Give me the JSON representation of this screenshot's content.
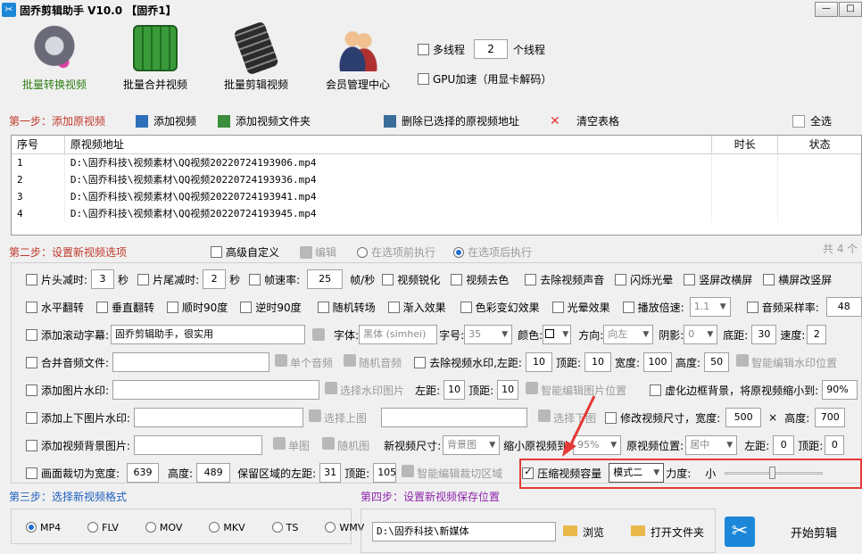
{
  "window": {
    "title": "固乔剪辑助手 V10.0 【固乔1】",
    "buttons": [
      "—",
      "□"
    ]
  },
  "toolbar": {
    "tools": [
      {
        "label": "批量转换视频",
        "active": true
      },
      {
        "label": "批量合并视频",
        "active": false
      },
      {
        "label": "批量剪辑视频",
        "active": false
      },
      {
        "label": "会员管理中心",
        "active": false
      }
    ],
    "multithread_label": "多线程",
    "thread_count": "2",
    "thread_unit": "个线程",
    "gpu_label": "GPU加速（用显卡解码）"
  },
  "step1": {
    "title": "第一步：添加原视频",
    "add_video": "添加视频",
    "add_folder": "添加视频文件夹",
    "delete_selected": "删除已选择的原视频地址",
    "clear_table": "清空表格",
    "select_all": "全选"
  },
  "table": {
    "headers": [
      "序号",
      "原视频地址",
      "时长",
      "状态"
    ],
    "rows": [
      {
        "no": "1",
        "path": "D:\\固乔科技\\视频素材\\QQ视频20220724193906.mp4"
      },
      {
        "no": "2",
        "path": "D:\\固乔科技\\视频素材\\QQ视频20220724193936.mp4"
      },
      {
        "no": "3",
        "path": "D:\\固乔科技\\视频素材\\QQ视频20220724193941.mp4"
      },
      {
        "no": "4",
        "path": "D:\\固乔科技\\视频素材\\QQ视频20220724193945.mp4"
      }
    ]
  },
  "step2": {
    "title": "第二步：设置新视频选项",
    "advanced": "高级自定义",
    "edit": "编辑",
    "before": "在选项前执行",
    "after": "在选项后执行",
    "count": "共 4 个"
  },
  "options": {
    "r1": {
      "cut_head": "片头减时:",
      "head_val": "3",
      "sec": "秒",
      "cut_tail": "片尾减时:",
      "tail_val": "2",
      "fps": "帧速率:",
      "fps_val": "25",
      "fps_unit": "帧/秒",
      "sharpen": "视频锐化",
      "decolor": "视频去色",
      "mute": "去除视频声音",
      "flash": "闪烁光晕",
      "v2h": "竖屏改横屏",
      "h2v": "横屏改竖屏"
    },
    "r2": {
      "hflip": "水平翻转",
      "vflip": "垂直翻转",
      "cw90": "顺时90度",
      "ccw90": "逆时90度",
      "random": "随机转场",
      "fadein": "渐入效果",
      "color": "色彩变幻效果",
      "halo": "光晕效果",
      "speed": "播放倍速:",
      "speed_val": "1.1",
      "sample": "音频采样率:",
      "sample_val": "48"
    },
    "r3": {
      "scroll": "添加滚动字幕:",
      "scroll_text": "固乔剪辑助手，很实用",
      "font": "字体:",
      "font_val": "黑体 (simhei)",
      "size": "字号:",
      "size_val": "35",
      "color": "颜色:",
      "dir": "方向:",
      "dir_val": "向左",
      "shadow": "阴影:",
      "shadow_val": "0",
      "bottom": "底距:",
      "bottom_val": "30",
      "spd": "速度:",
      "spd_val": "2"
    },
    "r4": {
      "merge": "合并音频文件:",
      "single": "单个音频",
      "random": "随机音频",
      "rm_wm": "去除视频水印,",
      "left": "左距:",
      "left_val": "10",
      "top": "顶距:",
      "top_val": "10",
      "w": "宽度:",
      "w_val": "100",
      "h": "高度:",
      "h_val": "50",
      "smart": "智能编辑水印位置"
    },
    "r5": {
      "img_wm": "添加图片水印:",
      "pick": "选择水印图片",
      "left": "左距:",
      "left_val": "10",
      "top": "顶距:",
      "top_val": "10",
      "smart": "智能编辑图片位置",
      "blur": "虚化边框背景，将原视频缩小到:",
      "blur_val": "90%"
    },
    "r6": {
      "tb_img": "添加上下图片水印:",
      "pick_top": "选择上图",
      "pick_bottom": "选择下图",
      "resize": "修改视频尺寸，宽度:",
      "w_val": "500",
      "x": "×",
      "h": "高度:",
      "h_val": "700"
    },
    "r7": {
      "bg_img": "添加视频背景图片:",
      "single": "单图",
      "random": "随机图",
      "new_size": "新视频尺寸:",
      "new_size_val": "背景图",
      "shrink": "缩小原视频到:",
      "shrink_val": "95%",
      "pos": "原视频位置:",
      "pos_val": "居中",
      "left": "左距:",
      "left_val": "0",
      "top": "顶距:",
      "top_val": "0"
    },
    "r8": {
      "crop": "画面裁切为宽度:",
      "w_val": "639",
      "h": "高度:",
      "h_val": "489",
      "keep": "保留区域的左距:",
      "left_val": "31",
      "top": "顶距:",
      "top_val": "105",
      "smart": "智能编辑裁切区域",
      "compress": "压缩视频容量",
      "mode_val": "模式二",
      "force": "力度:",
      "small": "小"
    }
  },
  "step3": {
    "title": "第三步：选择新视频格式",
    "formats": [
      "MP4",
      "FLV",
      "MOV",
      "MKV",
      "TS",
      "WMV"
    ]
  },
  "step4": {
    "title": "第四步：设置新视频保存位置",
    "path": "D:\\固乔科技\\新媒体",
    "browse": "浏览",
    "open_folder": "打开文件夹",
    "start": "开始剪辑"
  },
  "colors": {
    "step_red": "#c0392b",
    "step_blue": "#1f5fbf",
    "step_purple": "#8e24aa",
    "highlight": "#e53935"
  }
}
